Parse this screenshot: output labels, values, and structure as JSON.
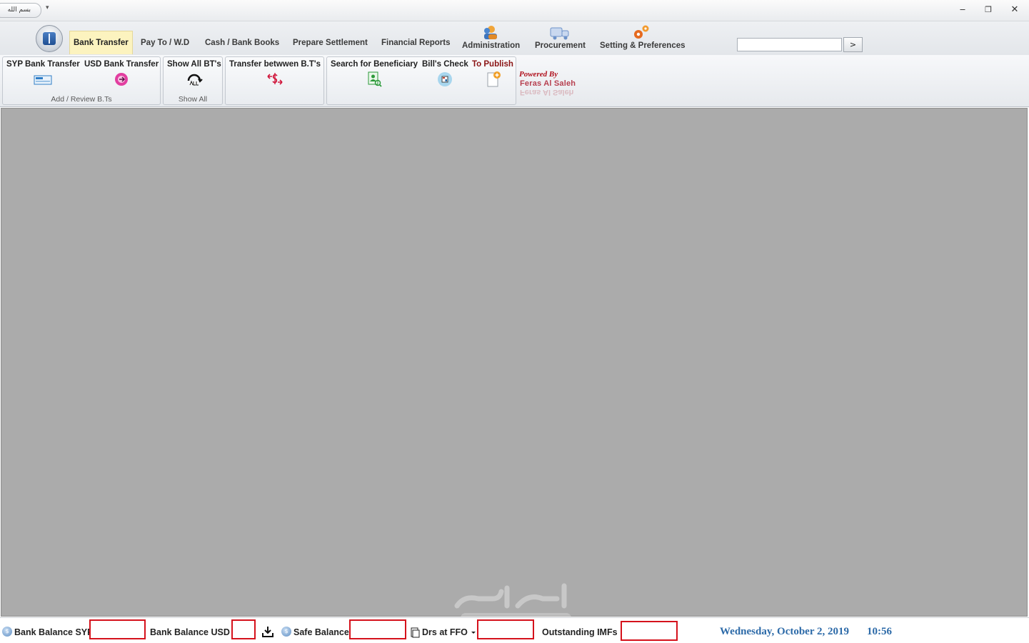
{
  "titlebar": {
    "qat_label": "بسم الله",
    "qat_arrow": "▾",
    "minimize": "‒",
    "restore": "❐",
    "close": "✕"
  },
  "tabs": {
    "bank_transfer": "Bank Transfer",
    "pay_to": "Pay To / W.D",
    "cash_books": "Cash  / Bank Books",
    "prepare_settlement": "Prepare Settlement",
    "financial_reports": "Financial Reports",
    "administration": "Administration",
    "procurement": "Procurement",
    "settings": "Setting & Preferences"
  },
  "search": {
    "go_label": ">"
  },
  "ribbon": {
    "group_add_review": {
      "title": "Add / Review B.Ts",
      "syp": "SYP Bank Transfer",
      "usd": "USD Bank Transfer"
    },
    "group_show_all": {
      "title": "Show All",
      "show_all": "Show All BT's"
    },
    "group_transfer": {
      "transfer": "Transfer betwwen B.T's"
    },
    "group_tools": {
      "search": "Search for Beneficiary",
      "bills": "Bill's Check",
      "publish": "To Publish"
    },
    "powered_by": "Powered By",
    "author": "Feras  Al  Saleh"
  },
  "statusbar": {
    "bank_syp": "Bank Balance SYP",
    "bank_usd": "Bank Balance USD",
    "safe": "Safe Balance",
    "drs": "Drs at FFO",
    "outstanding": "Outstanding IMFs",
    "date": "Wednesday, October 2, 2019",
    "time": "10:56"
  },
  "colors": {
    "accent_active_tab": "#fcf3bf",
    "workspace": "#ababab",
    "highlight_box": "#d5121c",
    "date_text": "#2c6aa8"
  }
}
